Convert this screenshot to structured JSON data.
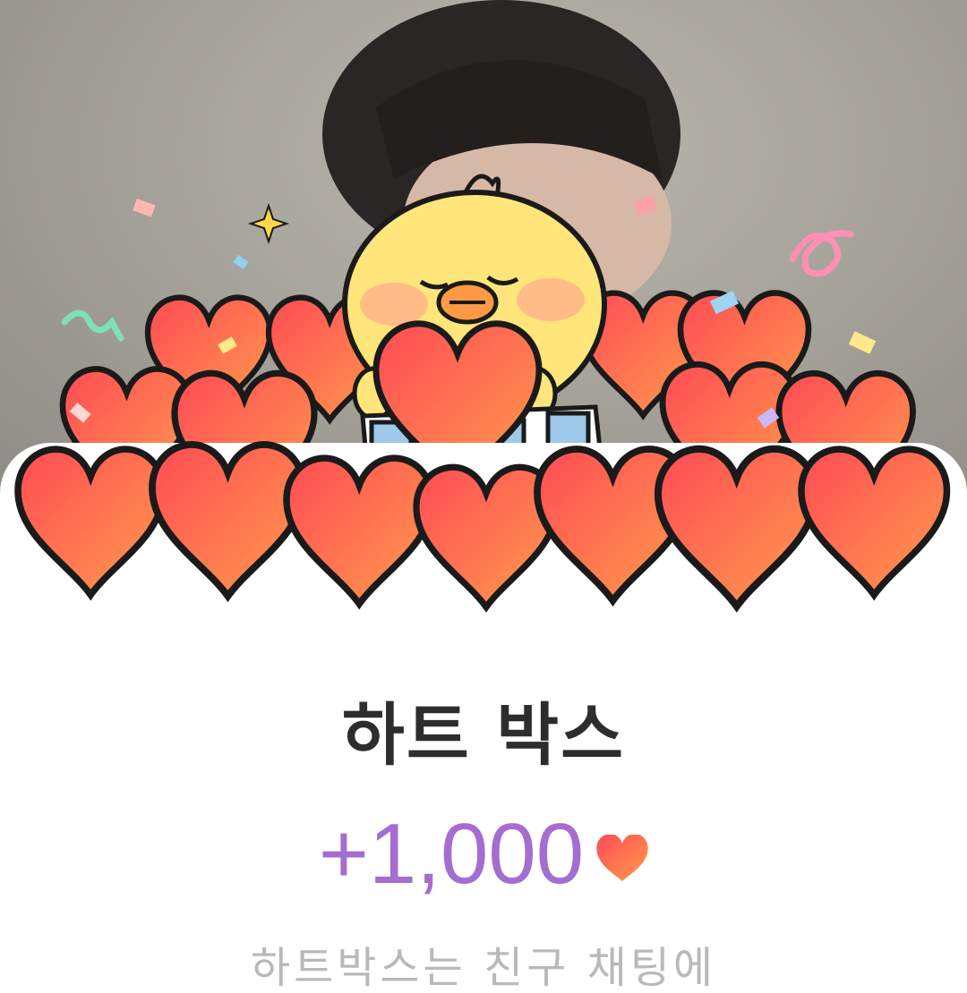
{
  "popup": {
    "title": "하트 박스",
    "reward_amount": "+1,000",
    "reward_icon": "heart-icon",
    "description": "하트박스는 친구 채팅에"
  },
  "colors": {
    "title": "#2d2d2d",
    "amount": "#a56dcf",
    "heart_top": "#ff4d57",
    "heart_bottom": "#ff9a4a",
    "chick": "#ffe57a"
  }
}
